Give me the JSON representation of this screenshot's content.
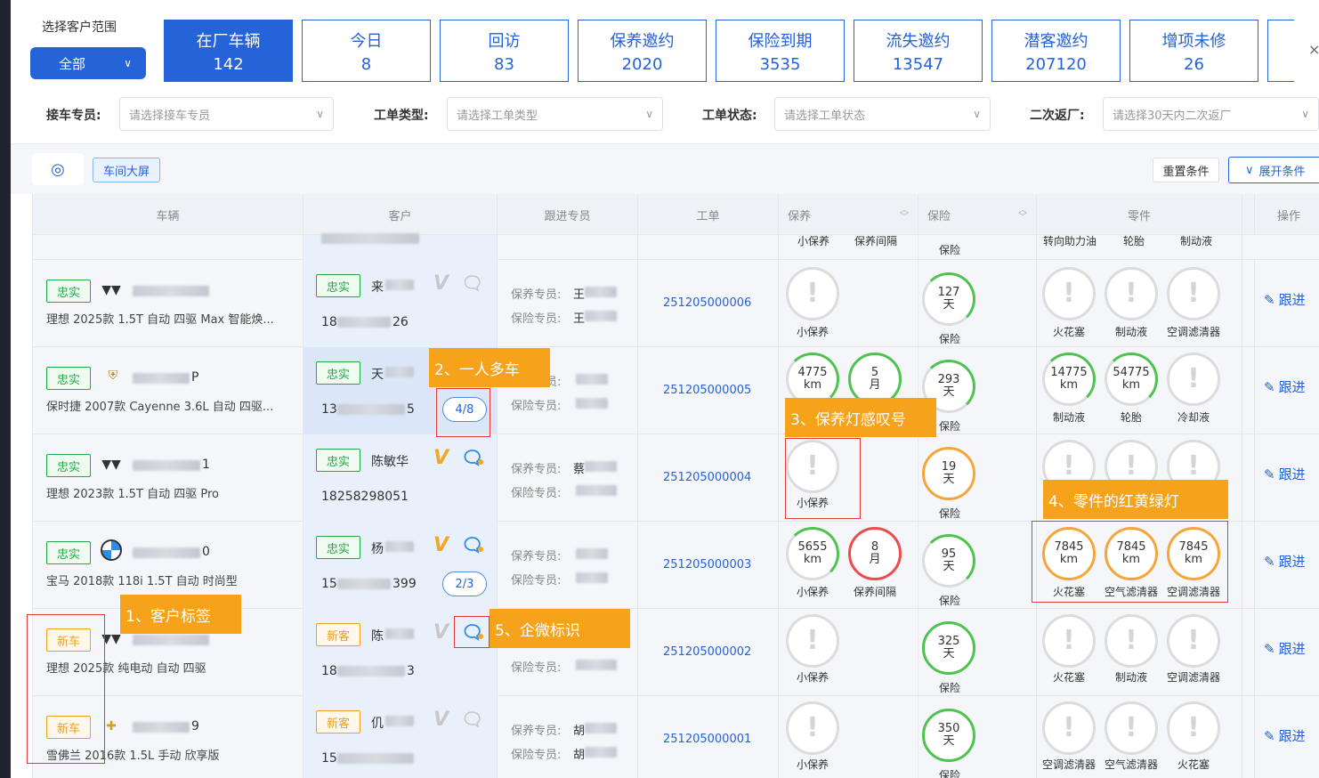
{
  "scope": {
    "label": "选择客户范围",
    "value": "全部"
  },
  "stats": [
    {
      "label": "在厂车辆",
      "value": "142",
      "active": true
    },
    {
      "label": "今日",
      "value": "8"
    },
    {
      "label": "回访",
      "value": "83"
    },
    {
      "label": "保养邀约",
      "value": "2020"
    },
    {
      "label": "保险到期",
      "value": "3535"
    },
    {
      "label": "流失邀约",
      "value": "13547"
    },
    {
      "label": "潜客邀约",
      "value": "207120"
    },
    {
      "label": "增项未修",
      "value": "26"
    }
  ],
  "filters": [
    {
      "label": "接车专员:",
      "placeholder": "请选择接车专员"
    },
    {
      "label": "工单类型:",
      "placeholder": "请选择工单类型"
    },
    {
      "label": "工单状态:",
      "placeholder": "请选择工单状态"
    },
    {
      "label": "二次返厂:",
      "placeholder": "请选择30天内二次返厂"
    }
  ],
  "toolbar": {
    "big_screen": "车间大屏",
    "reset": "重置条件",
    "expand": "展开条件"
  },
  "columns": {
    "vehicle": "车辆",
    "customer": "客户",
    "follower": "跟进专员",
    "order": "工单",
    "maintenance": "保养",
    "insurance": "保险",
    "parts": "零件",
    "action": "操作"
  },
  "partial_row": {
    "m1": "小保养",
    "m2": "保养间隔",
    "ins": "保险",
    "p1": "转向助力油",
    "p2": "轮胎",
    "p3": "制动液"
  },
  "labels": {
    "maint_staff": "保养专员:",
    "ins_staff": "保险专员:",
    "follow": "跟进",
    "km": "km",
    "day": "天",
    "month": "月"
  },
  "rows": [
    {
      "tag": "忠实",
      "tag_type": "loyal",
      "plate_tail": "",
      "model": "理想 2025款 1.5T 自动 四驱 Max 智能焕...",
      "ctag": "忠实",
      "ctag_type": "loyal",
      "cust_name_first": "来",
      "phone_head": "18",
      "phone_tail": "26",
      "order": "251205000006",
      "maint_label": "小保养",
      "ins_value": "127",
      "parts": [
        "火花塞",
        "制动液",
        "空调滤清器"
      ]
    },
    {
      "tag": "忠实",
      "tag_type": "loyal",
      "plate_tail": "P",
      "model": "保时捷 2007款 Cayenne 3.6L 自动 四驱...",
      "ctag": "忠实",
      "ctag_type": "loyal",
      "cust_name_first": "天",
      "phone_head": "13",
      "phone_tail": "5",
      "multi": "4/8",
      "order": "251205000005",
      "maint_km": "4775",
      "maint_month": "5",
      "ins_value": "293",
      "parts_km": [
        "14775",
        "54775"
      ],
      "parts": [
        "制动液",
        "轮胎",
        "冷却液"
      ]
    },
    {
      "tag": "忠实",
      "tag_type": "loyal",
      "plate_tail": "1",
      "model": "理想 2023款 1.5T 自动 四驱 Pro",
      "ctag": "忠实",
      "ctag_type": "loyal",
      "cust_name": "陈敏华",
      "phone": "18258298051",
      "order": "251205000004",
      "maint_label": "小保养",
      "ins_value": "19"
    },
    {
      "tag": "忠实",
      "tag_type": "loyal",
      "plate_tail": "0",
      "model": "宝马 2018款 118i 1.5T 自动 时尚型",
      "ctag": "忠实",
      "ctag_type": "loyal",
      "cust_name_first": "杨",
      "phone_head": "15",
      "phone_tail": "399",
      "multi": "2/3",
      "order": "251205000003",
      "maint_km": "5655",
      "maint_month": "8",
      "maint_label": "小保养",
      "maint_label2": "保养间隔",
      "ins_value": "95",
      "parts_km": [
        "7845",
        "7845",
        "7845"
      ],
      "parts": [
        "火花塞",
        "空气滤清器",
        "空调滤清器"
      ]
    },
    {
      "tag": "新车",
      "tag_type": "new",
      "plate_tail": "",
      "model": "理想 2025款 纯电动 自动 四驱",
      "ctag": "新客",
      "ctag_type": "new",
      "cust_name_first": "陈",
      "phone_head": "18",
      "phone_tail": "3",
      "order": "251205000002",
      "maint_label": "小保养",
      "ins_value": "325",
      "parts": [
        "火花塞",
        "制动液",
        "空调滤清器"
      ]
    },
    {
      "tag": "新车",
      "tag_type": "new",
      "plate_tail": "9",
      "model": "雪佛兰 2016款 1.5L 手动 欣享版",
      "ctag": "新客",
      "ctag_type": "new",
      "cust_name_first": "仉",
      "phone_head": "15",
      "phone_tail": "",
      "order": "251205000001",
      "maint_label": "小保养",
      "ins_value": "350",
      "parts": [
        "空调滤清器",
        "空气滤清器",
        "火花塞"
      ]
    }
  ],
  "maint_staff_prefix": [
    "王",
    "",
    "蔡",
    "",
    "",
    "胡"
  ],
  "ins_staff_prefix": [
    "王",
    "",
    "",
    "",
    "",
    "胡"
  ],
  "callouts": [
    "1、客户标签",
    "2、一人多车",
    "3、保养灯感叹号",
    "4、零件的红黄绿灯",
    "5、企微标识"
  ],
  "colors": {
    "primary": "#2563d8",
    "loyal": "#22a845",
    "new": "#f0a020",
    "callout": "#f7a21b",
    "alert": "#e53935"
  }
}
